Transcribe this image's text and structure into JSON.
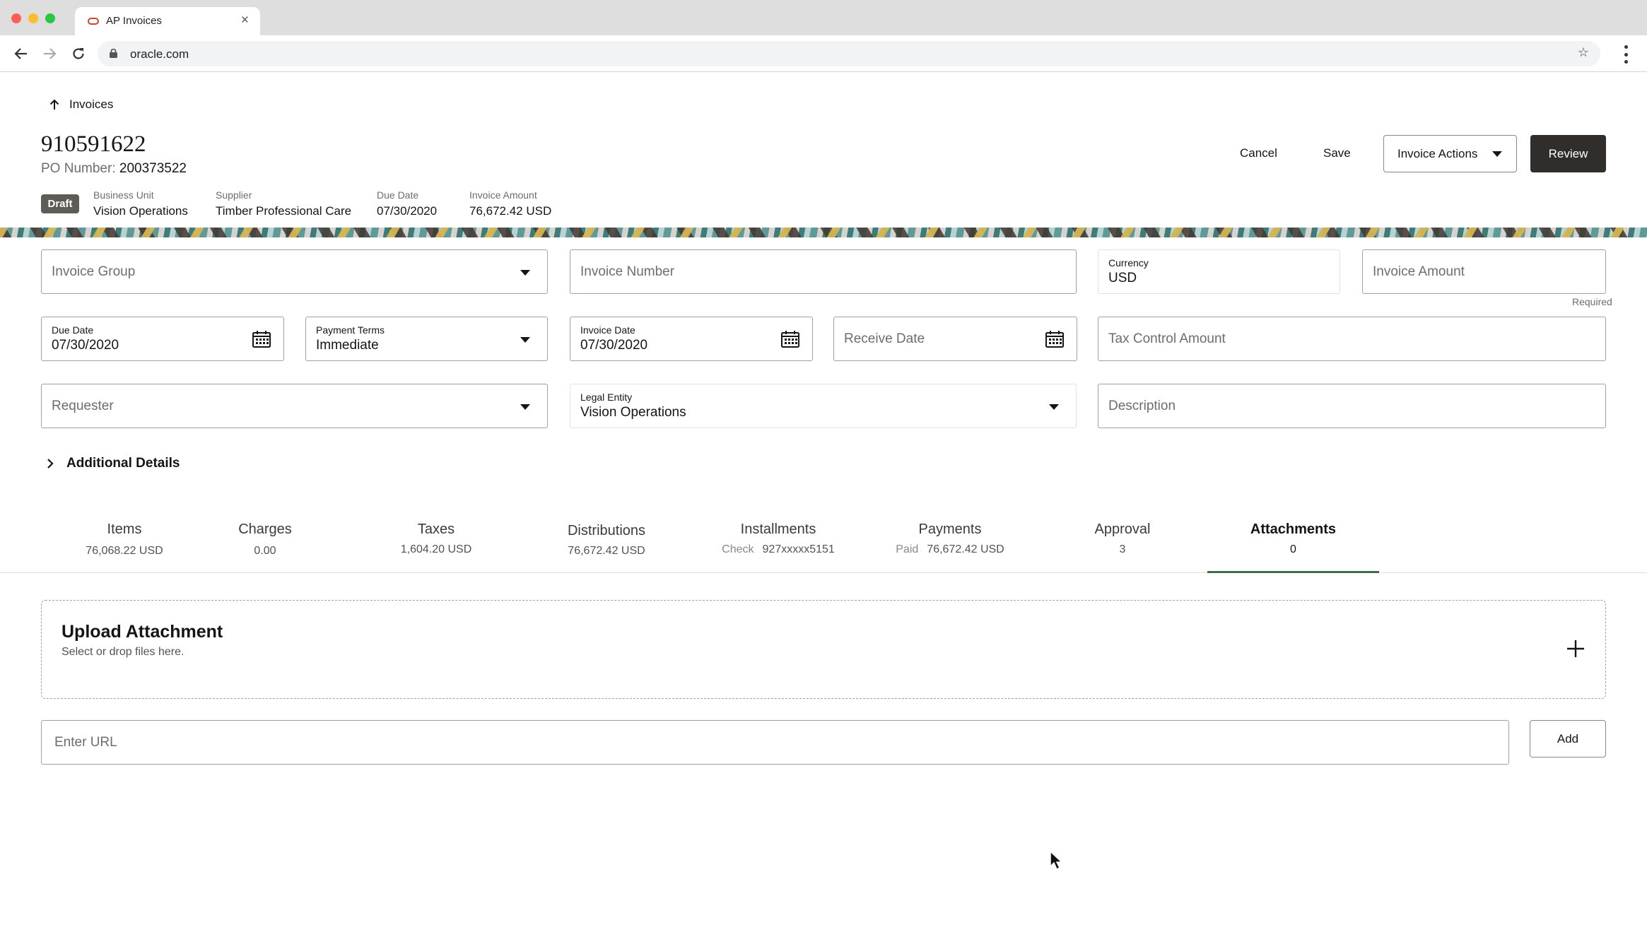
{
  "browser": {
    "tab_title": "AP Invoices",
    "url": "oracle.com"
  },
  "page": {
    "breadcrumb": "Invoices",
    "title": "910591622",
    "po_label": "PO Number:",
    "po_value": "200373522",
    "actions": {
      "cancel": "Cancel",
      "save": "Save",
      "invoice_actions": "Invoice Actions",
      "review": "Review"
    },
    "status_badge": "Draft",
    "meta": [
      {
        "label": "Business Unit",
        "value": "Vision Operations"
      },
      {
        "label": "Supplier",
        "value": "Timber Professional Care"
      },
      {
        "label": "Due Date",
        "value": "07/30/2020"
      },
      {
        "label": "Invoice Amount",
        "value": "76,672.42 USD"
      }
    ]
  },
  "form": {
    "invoice_group": {
      "placeholder": "Invoice Group"
    },
    "invoice_number": {
      "placeholder": "Invoice Number"
    },
    "currency": {
      "label": "Currency",
      "value": "USD"
    },
    "invoice_amount": {
      "placeholder": "Invoice Amount",
      "hint": "Required"
    },
    "due_date": {
      "label": "Due Date",
      "value": "07/30/2020"
    },
    "payment_terms": {
      "label": "Payment Terms",
      "value": "Immediate"
    },
    "invoice_date": {
      "label": "Invoice Date",
      "value": "07/30/2020"
    },
    "receive_date": {
      "placeholder": "Receive Date"
    },
    "tax_control_amount": {
      "placeholder": "Tax Control Amount"
    },
    "requester": {
      "placeholder": "Requester"
    },
    "legal_entity": {
      "label": "Legal Entity",
      "value": "Vision Operations"
    },
    "description": {
      "placeholder": "Description"
    },
    "additional_details": "Additional Details"
  },
  "tabs": [
    {
      "label": "Items",
      "prefix": "",
      "value": "76,068.22 USD"
    },
    {
      "label": "Charges",
      "prefix": "",
      "value": "0.00"
    },
    {
      "label": "Taxes",
      "prefix": "",
      "value": "1,604.20 USD"
    },
    {
      "label": "Distributions",
      "prefix": "",
      "value": "76,672.42 USD"
    },
    {
      "label": "Installments",
      "prefix": "Check",
      "value": "927xxxxx5151"
    },
    {
      "label": "Payments",
      "prefix": "Paid",
      "value": "76,672.42 USD"
    },
    {
      "label": "Approval",
      "prefix": "",
      "value": "3"
    },
    {
      "label": "Attachments",
      "prefix": "",
      "value": "0"
    }
  ],
  "active_tab": "Attachments",
  "attachments": {
    "upload_title": "Upload Attachment",
    "upload_hint": "Select or drop files here.",
    "url_placeholder": "Enter URL",
    "add_label": "Add"
  },
  "icons": [
    "back-arrow-icon",
    "forward-arrow-icon",
    "reload-icon",
    "lock-icon",
    "star-icon",
    "kebab-menu-icon",
    "up-arrow-icon",
    "chevron-down-icon",
    "calendar-icon",
    "chevron-right-icon",
    "plus-icon",
    "mouse-pointer-icon"
  ],
  "colors": {
    "primary_button": "#312d2a",
    "active_tab_underline": "#3d6e48",
    "draft_badge": "#5f5b57"
  }
}
